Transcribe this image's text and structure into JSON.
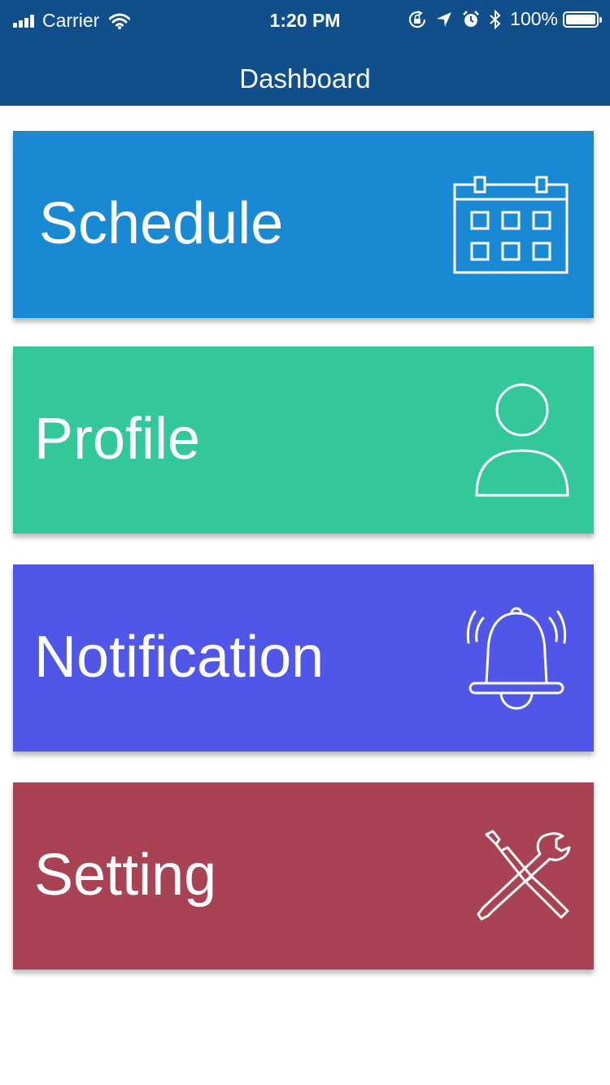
{
  "status_bar": {
    "carrier": "Carrier",
    "time": "1:20 PM",
    "battery": "100%"
  },
  "header": {
    "title": "Dashboard",
    "color": "#114e8c"
  },
  "cards": [
    {
      "label": "Schedule",
      "icon": "calendar-icon",
      "color": "#1989d4"
    },
    {
      "label": "Profile",
      "icon": "user-icon",
      "color": "#33c89a"
    },
    {
      "label": "Notification",
      "icon": "bell-icon",
      "color": "#5056e8"
    },
    {
      "label": "Setting",
      "icon": "tools-icon",
      "color": "#a94353"
    }
  ]
}
